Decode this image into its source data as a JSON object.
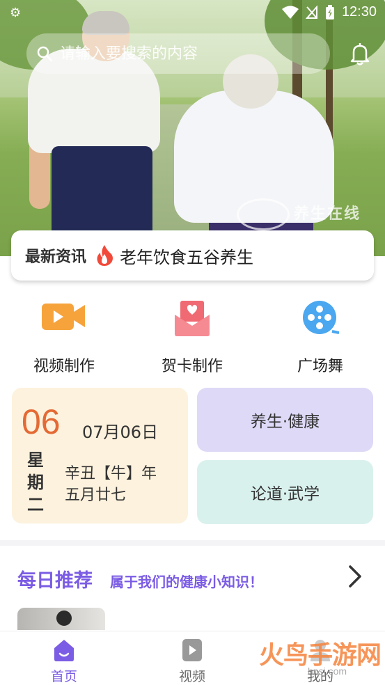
{
  "status_bar": {
    "time": "12:30"
  },
  "search": {
    "placeholder": "请输入要搜索的内容"
  },
  "banner": {
    "watermark": "养生在线"
  },
  "news": {
    "title": "最新资讯",
    "headline": "老年饮食五谷养生"
  },
  "features": [
    {
      "label": "视频制作",
      "icon": "video-camera-icon"
    },
    {
      "label": "贺卡制作",
      "icon": "greeting-card-icon"
    },
    {
      "label": "广场舞",
      "icon": "film-reel-icon"
    }
  ],
  "calendar": {
    "day": "06",
    "date": "07月06日",
    "weekday": "星期二",
    "lunar_year": "辛丑【牛】年",
    "lunar_date": "五月廿七"
  },
  "tiles": {
    "health": "养生·健康",
    "martial": "论道·武学"
  },
  "daily": {
    "title": "每日推荐",
    "subtitle": "属于我们的健康小知识！"
  },
  "nav": [
    {
      "label": "首页",
      "active": true
    },
    {
      "label": "视频",
      "active": false
    },
    {
      "label": "我的",
      "active": false
    }
  ],
  "corner_watermark": {
    "main": "火鸟手游网",
    "url": "hnsj.com"
  },
  "colors": {
    "accent": "#7b5ce4",
    "calendar_day": "#e46a35",
    "health_tile": "#ddd9f7",
    "martial_tile": "#d9f1ed",
    "calendar_bg": "#fdf2dd"
  }
}
